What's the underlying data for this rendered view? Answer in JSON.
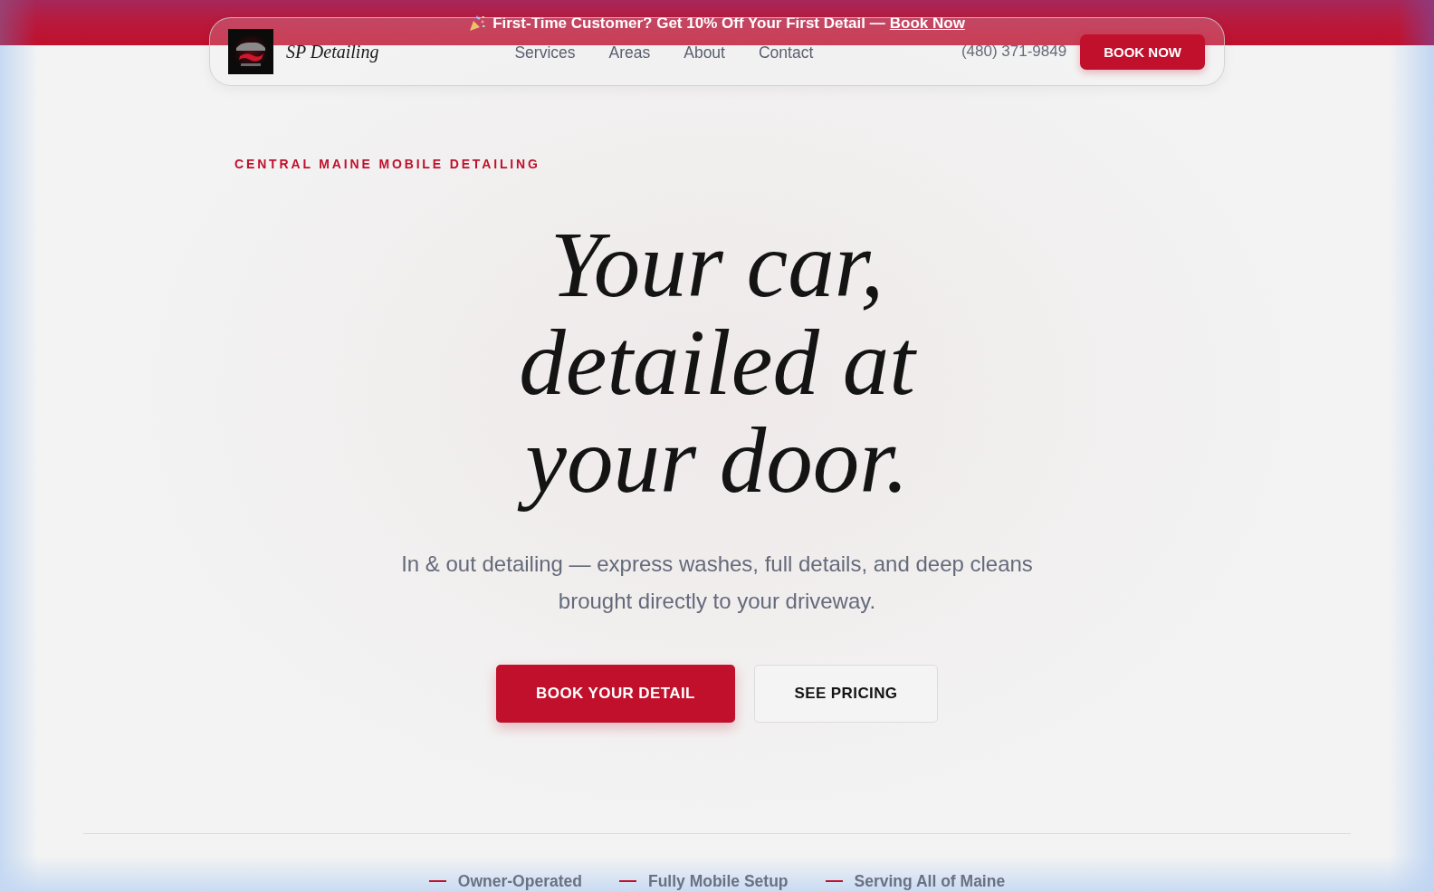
{
  "promo_banner": {
    "text": "First-Time Customer? Get **10% Off** Your First Detail —",
    "link": "Book Now"
  },
  "nav": {
    "brand": "SP Detailing",
    "links": [
      "Services",
      "Areas",
      "About",
      "Contact"
    ],
    "phone": "(480) 371-9849",
    "cta": "BOOK NOW"
  },
  "hero": {
    "eyebrow": "CENTRAL MAINE MOBILE DETAILING",
    "headline": "Your car, detailed at your door.",
    "subtitle": "In & out detailing — express washes, full details, and deep cleans brought directly to your driveway.",
    "buttons": [
      {
        "label": "BOOK YOUR DETAIL",
        "kind": "primary"
      },
      {
        "label": "SEE PRICING",
        "kind": "secondary"
      }
    ]
  },
  "features": [
    "Owner-Operated",
    "Fully Mobile Setup",
    "Serving All of Maine"
  ]
}
